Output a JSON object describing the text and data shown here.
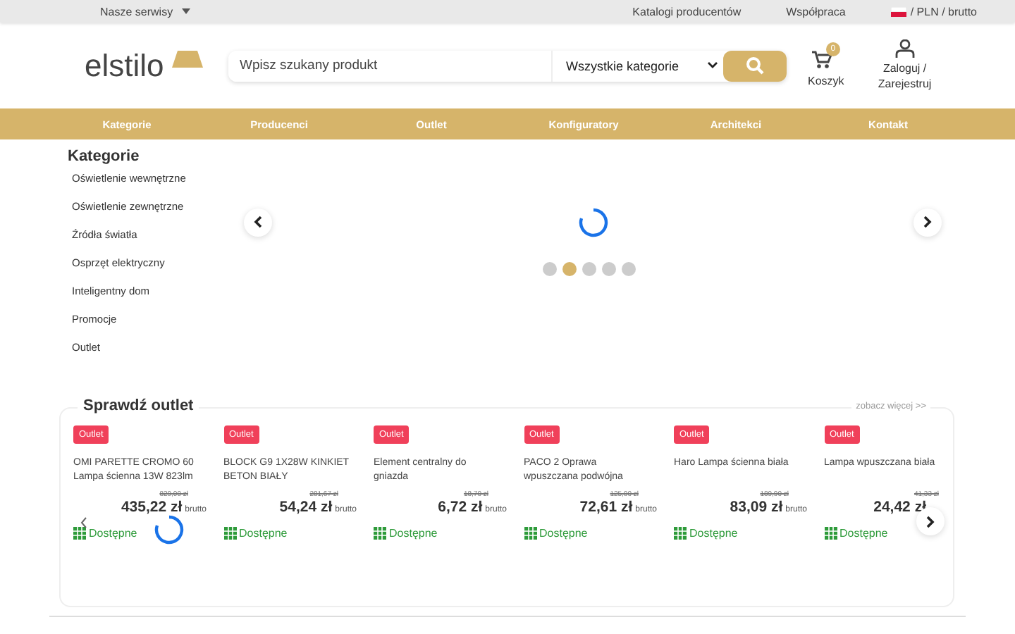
{
  "topbar": {
    "services": "Nasze serwisy",
    "links": [
      "Katalogi producentów",
      "Współpraca"
    ],
    "currency": "/ PLN / brutto"
  },
  "header": {
    "logo": "elstilo",
    "search": {
      "placeholder": "Wpisz szukany produkt"
    },
    "category_select": "Wszystkie kategorie",
    "cart": {
      "label": "Koszyk",
      "count": "0"
    },
    "account": "Zaloguj / Zarejestruj"
  },
  "nav": [
    "Kategorie",
    "Producenci",
    "Outlet",
    "Konfiguratory",
    "Architekci",
    "Kontakt"
  ],
  "categories": {
    "title": "Kategorie",
    "items": [
      "Oświetlenie wewnętrzne",
      "Oświetlenie zewnętrzne",
      "Źródła światła",
      "Osprzęt elektryczny",
      "Inteligentny dom",
      "Promocje",
      "Outlet"
    ]
  },
  "slider": {
    "loading": true,
    "dots": [
      {
        "selected": false
      },
      {
        "selected": true
      },
      {
        "selected": false
      },
      {
        "selected": false
      },
      {
        "selected": false
      }
    ]
  },
  "outlet": {
    "title": "Sprawdź outlet",
    "more": "zobacz więcej >>",
    "loading": true,
    "products": [
      {
        "badge": "Outlet",
        "name": "OMI PARETTE CROMO 60 Lampa ścienna 13W 823lm",
        "old_price": "829,00 zł",
        "price": "435,22 zł",
        "unit": "brutto",
        "availability": "Dostępne"
      },
      {
        "badge": "Outlet",
        "name": "BLOCK G9 1X28W KINKIET BETON BIAŁY",
        "old_price": "281,67 zł",
        "price": "54,24 zł",
        "unit": "brutto",
        "availability": "Dostępne"
      },
      {
        "badge": "Outlet",
        "name": "Element centralny do gniazda",
        "old_price": "18,70 zł",
        "price": "6,72 zł",
        "unit": "brutto",
        "availability": "Dostępne"
      },
      {
        "badge": "Outlet",
        "name": "PACO 2 Oprawa wpuszczana podwójna",
        "old_price": "125,00 zł",
        "price": "72,61 zł",
        "unit": "brutto",
        "availability": "Dostępne"
      },
      {
        "badge": "Outlet",
        "name": "Haro Lampa ścienna biała",
        "old_price": "189,90 zł",
        "price": "83,09 zł",
        "unit": "brutto",
        "availability": "Dostępne"
      },
      {
        "badge": "Outlet",
        "name": "Lampa wpuszczana biała",
        "old_price": "41,33 zł",
        "price": "24,42 zł",
        "availability": "Dostępne"
      }
    ]
  }
}
